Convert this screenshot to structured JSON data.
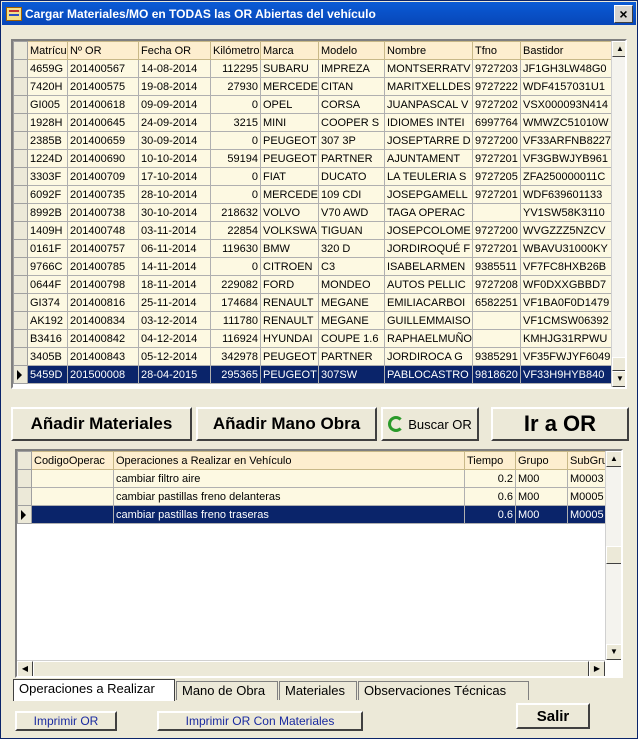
{
  "window": {
    "title": "Cargar Materiales/MO en TODAS las OR Abiertas del vehículo",
    "close": "×"
  },
  "orders": {
    "columns": [
      "Matrícula",
      "Nº OR",
      "Fecha OR",
      "Kilómetros",
      "Marca",
      "Modelo",
      "Nombre",
      "Tfno",
      "Bastidor"
    ],
    "rows": [
      [
        "4659G",
        "201400567",
        "14-08-2014",
        "112295",
        "SUBARU",
        "IMPREZA",
        "MONTSERRATV",
        "9727203",
        "JF1GH3LW48G0"
      ],
      [
        "7420H",
        "201400575",
        "19-08-2014",
        "27930",
        "MERCEDE",
        "CITAN",
        "MARITXELLDES",
        "9727222",
        "WDF4157031U1"
      ],
      [
        "GI005",
        "201400618",
        "09-09-2014",
        "0",
        "OPEL",
        "CORSA",
        "JUANPASCAL V",
        "9727202",
        "VSX000093N414"
      ],
      [
        "1928H",
        "201400645",
        "24-09-2014",
        "3215",
        "MINI",
        "COOPER S",
        "IDIOMES INTEI",
        "6997764",
        "WMWZC51010W"
      ],
      [
        "2385B",
        "201400659",
        "30-09-2014",
        "0",
        "PEUGEOT",
        "307 3P",
        "JOSEPTARRE D",
        "9727200",
        "VF33ARFNB8227"
      ],
      [
        "1224D",
        "201400690",
        "10-10-2014",
        "59194",
        "PEUGEOT",
        "PARTNER",
        "AJUNTAMENT",
        "9727201",
        "VF3GBWJYB961"
      ],
      [
        "3303F",
        "201400709",
        "17-10-2014",
        "0",
        "FIAT",
        "DUCATO",
        "LA TEULERIA S",
        "9727205",
        "ZFA250000011C"
      ],
      [
        "6092F",
        "201400735",
        "28-10-2014",
        "0",
        "MERCEDE",
        "109 CDI",
        "JOSEPGAMELL",
        "9727201",
        "WDF639601133"
      ],
      [
        "8992B",
        "201400738",
        "30-10-2014",
        "218632",
        "VOLVO",
        "V70 AWD",
        "TAGA OPERAC",
        "",
        "YV1SW58K3110"
      ],
      [
        "1409H",
        "201400748",
        "03-11-2014",
        "22854",
        "VOLKSWA",
        "TIGUAN",
        "JOSEPCOLOME",
        "9727200",
        "WVGZZZ5NZCV"
      ],
      [
        "0161F",
        "201400757",
        "06-11-2014",
        "119630",
        "BMW",
        "320 D",
        "JORDIROQUÉ F",
        "9727201",
        "WBAVU31000KY"
      ],
      [
        "9766C",
        "201400785",
        "14-11-2014",
        "0",
        "CITROEN",
        "C3",
        "ISABELARMEN",
        "9385511",
        "VF7FC8HXB26B"
      ],
      [
        "0644F",
        "201400798",
        "18-11-2014",
        "229082",
        "FORD",
        "MONDEO",
        "AUTOS PELLIC",
        "9727208",
        "WF0DXXGBBD7"
      ],
      [
        "GI374",
        "201400816",
        "25-11-2014",
        "174684",
        "RENAULT",
        "MEGANE",
        "EMILIACARBOI",
        "6582251",
        "VF1BA0F0D1479"
      ],
      [
        "AK192",
        "201400834",
        "03-12-2014",
        "111780",
        "RENAULT",
        "MEGANE",
        "GUILLEMMAISO",
        "",
        "VF1CMSW06392"
      ],
      [
        "B3416",
        "201400842",
        "04-12-2014",
        "116924",
        "HYUNDAI",
        "COUPE 1.6",
        "RAPHAELMUÑO",
        "",
        "KMHJG31RPWU"
      ],
      [
        "3405B",
        "201400843",
        "05-12-2014",
        "342978",
        "PEUGEOT",
        "PARTNER",
        "JORDIROCA G",
        "9385291",
        "VF35FWJYF6049"
      ],
      [
        "5459D",
        "201500008",
        "28-04-2015",
        "295365",
        "PEUGEOT",
        "307SW",
        "PABLOCASTRO",
        "9818620",
        "VF33H9HYB840"
      ]
    ]
  },
  "buttons": {
    "add_materials": "Añadir Materiales",
    "add_labor": "Añadir Mano Obra",
    "search_or": "Buscar OR",
    "go_or": "Ir a OR",
    "print_or": "Imprimir OR",
    "print_or_materials": "Imprimir OR Con Materiales",
    "exit": "Salir"
  },
  "operations": {
    "columns": [
      "CodigoOperac",
      "Operaciones a Realizar en Vehículo",
      "Tiempo",
      "Grupo",
      "SubGru"
    ],
    "rows": [
      [
        "",
        "cambiar filtro aire",
        "0.2",
        "M00",
        "M0003"
      ],
      [
        "",
        "cambiar pastillas freno delanteras",
        "0.6",
        "M00",
        "M0005"
      ],
      [
        "",
        "cambiar pastillas freno traseras",
        "0.6",
        "M00",
        "M0005"
      ]
    ]
  },
  "tabs": [
    "Operaciones a Realizar",
    "Mano de Obra",
    "Materiales",
    "Observaciones Técnicas"
  ]
}
